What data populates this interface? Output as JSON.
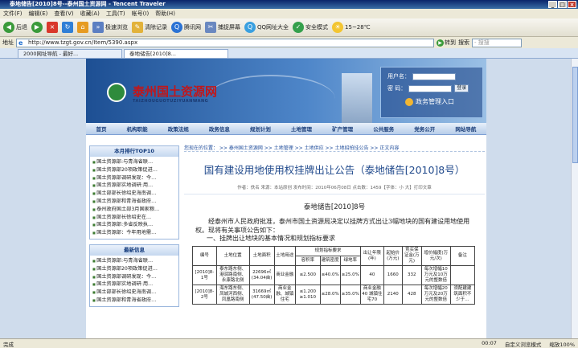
{
  "window": {
    "title": "泰地储告[2010]8号--泰州国土资源网 - Tencent Traveler"
  },
  "menu": [
    "文件(F)",
    "编辑(E)",
    "查看(V)",
    "收藏(A)",
    "工具(T)",
    "帐号(I)",
    "帮助(H)"
  ],
  "toolbar": {
    "back": "后退",
    "mode": "极速浏览",
    "clear": "清除记录",
    "tencent": "腾讯网",
    "capture": "捕捉屏幕",
    "qq": "QQ网址大全",
    "security": "安全模式",
    "weather": "15~28℃"
  },
  "address": {
    "label": "地址",
    "url": "http://www.tzgt.gov.cn/Item/5390.aspx",
    "go": "转到",
    "search_label": "搜索",
    "search_placeholder": "- 搜搜"
  },
  "tabs": [
    {
      "label": "2000网址导航 - 最好..."
    },
    {
      "label": "泰地储告[2010]8..."
    }
  ],
  "site": {
    "name": "泰州国土资源网",
    "pinyin": "TAIZHOUGUOTUZIYUANWANG",
    "login": {
      "user_label": "用户名：",
      "pass_label": "密  码：",
      "login_btn": "登录",
      "portal": "政务管理入口"
    },
    "nav": [
      "首页",
      "机构职能",
      "政策法规",
      "政务信息",
      "规划计划",
      "土地管理",
      "矿产管理",
      "公共服务",
      "党务公开",
      "网站导航"
    ]
  },
  "left": {
    "top10_title": "本月排行TOP10",
    "top10": [
      "国土资源部:与青海省联…",
      "国土资源部20项政策促进…",
      "国土资源部调研发现：今…",
      "国土资源部实地调研:用…",
      "国土部部长徐绍史海南调…",
      "国土资源部和青海省政府…",
      "泰州政府国土部3月国家粮…",
      "国土资源部长徐绍史在…",
      "国土资源部:多省反映执…",
      "国土资源部：今年用地需…"
    ],
    "latest_title": "最新信息",
    "latest": [
      "国土资源部:与青海省联…",
      "国土资源部20项政策促进…",
      "国土资源部调研发现：今…",
      "国土资源部实地调研:用…",
      "国土部部长徐绍史海南调…",
      "国土资源部和青海省政府…"
    ]
  },
  "article": {
    "breadcrumb": "您现在的位置： >> 泰州国土资源网 >> 土地管理 >> 土地供应 >> 土地招拍挂公告 >> 正文内容",
    "title": "国有建设用地使用权挂牌出让公告（泰地储告[2010]8号）",
    "meta": "作者：佚名  来源：本站原创  发布时间：2010年06月08日  点击数：1459【字体：小 大】打印文章",
    "docno": "泰地储告[2010]8号",
    "para": "经泰州市人民政府批准，泰州市国土资源局决定以挂牌方式出让3幅地块的国有建设用地使用权。现将有关事项公告如下：",
    "section": "一、挂牌出让地块的基本情况和规划指标要求",
    "table": {
      "header": [
        "编号",
        "土地位置",
        "土地面积",
        "土地用途",
        "规划指标要求",
        "出让年限(年)",
        "起始价(万元)",
        "竞买保证金(万元)",
        "增价幅度(万元/次)",
        "备注"
      ],
      "subheader": [
        "容积率",
        "建筑密度",
        "绿地率"
      ],
      "rows": [
        [
          "[2010]8-1号",
          "泰东路东侧、港润路南侧、永康路北侧",
          "22696㎡(34.04亩)",
          "商业金融",
          "≤2.500",
          "≤40.0%",
          "≥25.0%",
          "40",
          "1660",
          "332",
          "每次增幅10万元及10万元的整数倍",
          ""
        ],
        [
          "[2010]8-2号",
          "海东路东侧、凤城河西侧、凤凰路南侧",
          "31669㎡(47.50亩)",
          "商业金融、城镇住宅",
          "≤1.200 ≥1.010",
          "≤28.0%",
          "≥35.0%",
          "商业金融40 城镇住宅70",
          "2140",
          "428",
          "每次增幅20万元及20万元的整数倍",
          "须配建建筑面积不少于…"
        ]
      ]
    }
  },
  "status": {
    "left": "完成",
    "time": "00:07",
    "mode": "自定义浏览模式",
    "zoom": "缩放100%"
  }
}
